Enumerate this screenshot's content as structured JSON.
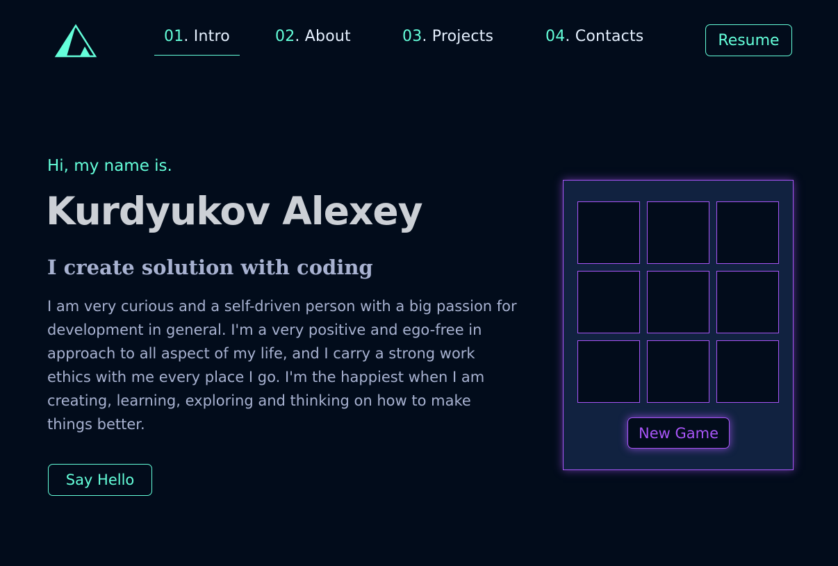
{
  "colors": {
    "background": "#020c1b",
    "accent": "#64ffda",
    "heading": "#ccd0d6",
    "text": "#a8b2d1",
    "nav_text": "#e6f1ff",
    "game_panel": "#112240",
    "game_accent": "#a855f7"
  },
  "header": {
    "logo_icon": "triangle-logo-icon",
    "nav": [
      {
        "num": "01",
        "label": ". Intro",
        "active": true
      },
      {
        "num": "02",
        "label": ". About",
        "active": false
      },
      {
        "num": "03",
        "label": ". Projects",
        "active": false
      },
      {
        "num": "04",
        "label": ". Contacts",
        "active": false
      }
    ],
    "resume_label": "Resume"
  },
  "hero": {
    "greeting": "Hi, my name is.",
    "name": "Kurdyukov Alexey",
    "tagline": "I create solution with coding",
    "bio": "I am very curious and a self-driven person with a big passion for development in general. I'm a very positive and ego-free in approach to all aspect of my life, and I carry a strong work ethics with me every place I go. I'm the happiest when I am creating, learning, exploring and thinking on how to make things better.",
    "cta_label": "Say Hello"
  },
  "game": {
    "cells": [
      "",
      "",
      "",
      "",
      "",
      "",
      "",
      "",
      ""
    ],
    "new_game_label": "New Game"
  }
}
